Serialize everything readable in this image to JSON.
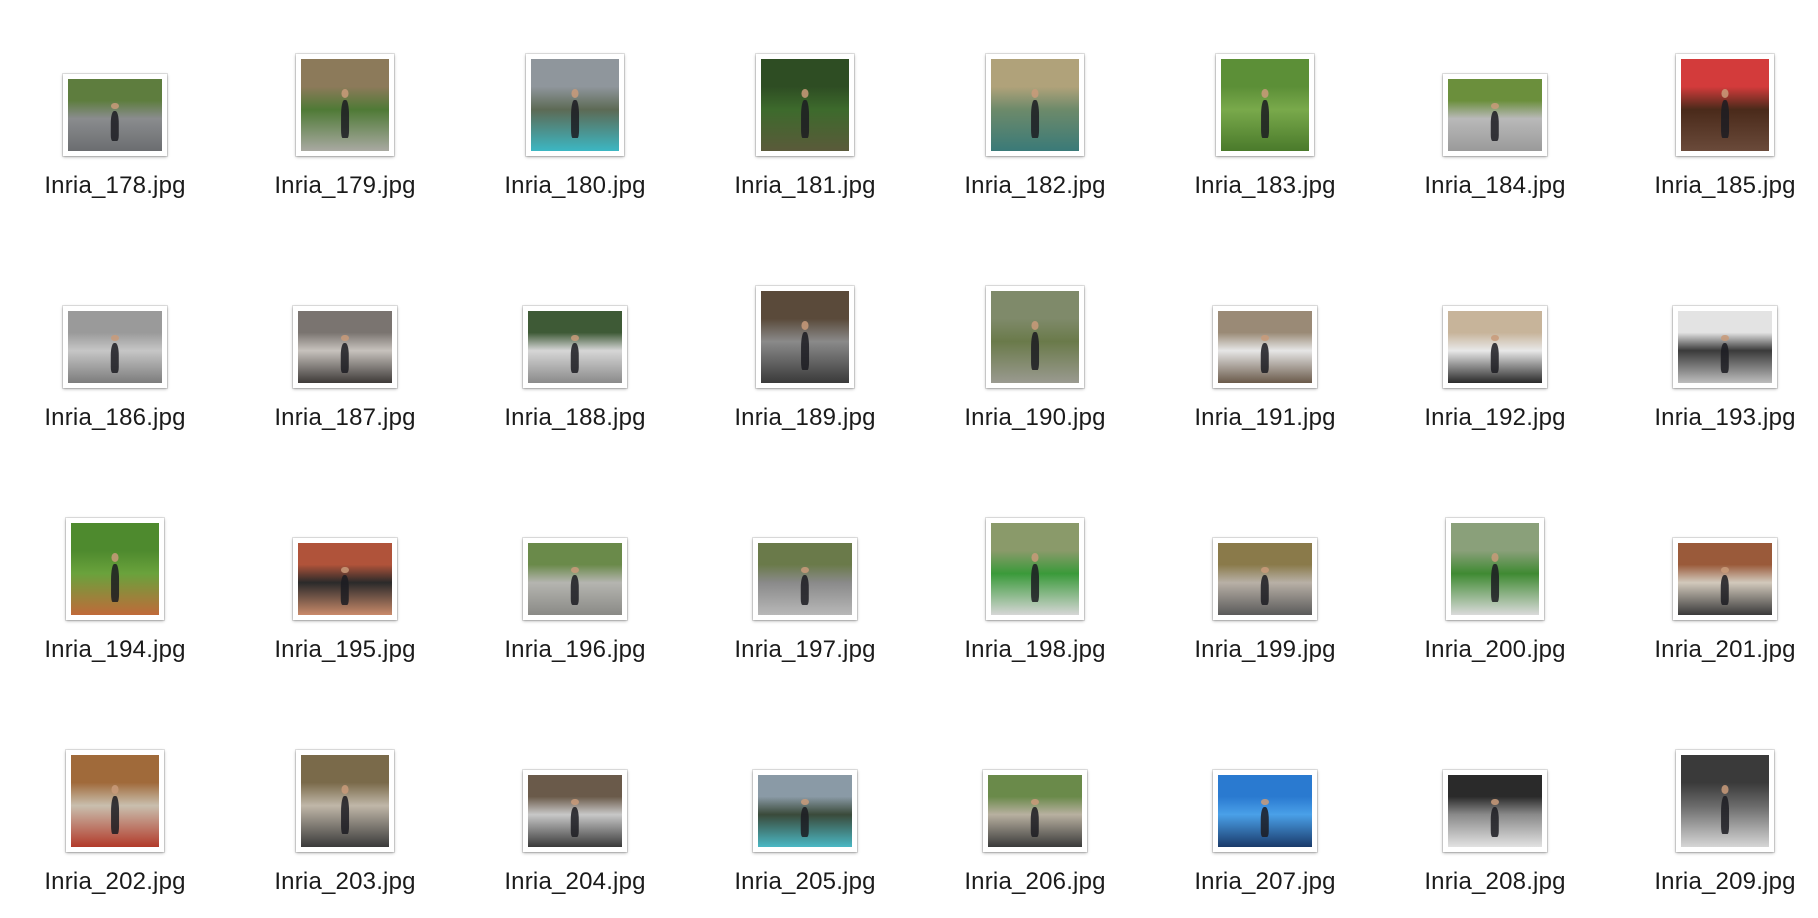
{
  "files": [
    {
      "name": "Inria_178.jpg",
      "colors": [
        "#5e7d3e",
        "#8a8c8e",
        "#6b6d70"
      ],
      "orientation": "landscape"
    },
    {
      "name": "Inria_179.jpg",
      "colors": [
        "#8c7a5a",
        "#4f7a36",
        "#a9a9a2"
      ],
      "orientation": "portrait"
    },
    {
      "name": "Inria_180.jpg",
      "colors": [
        "#8f969c",
        "#5d6a55",
        "#3cb7c3"
      ],
      "orientation": "portrait"
    },
    {
      "name": "Inria_181.jpg",
      "colors": [
        "#2e4d23",
        "#3d6a2c",
        "#5a5a3a"
      ],
      "orientation": "portrait"
    },
    {
      "name": "Inria_182.jpg",
      "colors": [
        "#b0a27a",
        "#6d8a6a",
        "#3a7a78"
      ],
      "orientation": "portrait"
    },
    {
      "name": "Inria_183.jpg",
      "colors": [
        "#5c8f37",
        "#79a94b",
        "#4a7a2b"
      ],
      "orientation": "portrait"
    },
    {
      "name": "Inria_184.jpg",
      "colors": [
        "#6b8f3c",
        "#b9b9b9",
        "#9a9a9a"
      ],
      "orientation": "landscape"
    },
    {
      "name": "Inria_185.jpg",
      "colors": [
        "#d33b3b",
        "#4a2a1a",
        "#6a4a3a"
      ],
      "orientation": "portrait"
    },
    {
      "name": "Inria_186.jpg",
      "colors": [
        "#9a9a9a",
        "#c6c6c6",
        "#7c7c7c"
      ],
      "orientation": "landscape"
    },
    {
      "name": "Inria_187.jpg",
      "colors": [
        "#7a7470",
        "#c7c2bd",
        "#3e3a38"
      ],
      "orientation": "landscape"
    },
    {
      "name": "Inria_188.jpg",
      "colors": [
        "#3e5a36",
        "#d6d6d6",
        "#8a8a8a"
      ],
      "orientation": "landscape"
    },
    {
      "name": "Inria_189.jpg",
      "colors": [
        "#5a4a3a",
        "#8a8a8a",
        "#3a3a3a"
      ],
      "orientation": "portrait"
    },
    {
      "name": "Inria_190.jpg",
      "colors": [
        "#7f8a6a",
        "#6a7a4a",
        "#9a9a90"
      ],
      "orientation": "portrait"
    },
    {
      "name": "Inria_191.jpg",
      "colors": [
        "#9a8a76",
        "#e6e6e6",
        "#6a5a4a"
      ],
      "orientation": "landscape"
    },
    {
      "name": "Inria_192.jpg",
      "colors": [
        "#c7b49a",
        "#e8e8e8",
        "#2a2a2a"
      ],
      "orientation": "landscape"
    },
    {
      "name": "Inria_193.jpg",
      "colors": [
        "#e3e3e3",
        "#3a3a3a",
        "#bdbdbd"
      ],
      "orientation": "landscape"
    },
    {
      "name": "Inria_194.jpg",
      "colors": [
        "#4e8a2e",
        "#6aa23c",
        "#c06a3a"
      ],
      "orientation": "portrait"
    },
    {
      "name": "Inria_195.jpg",
      "colors": [
        "#b0533a",
        "#2a2a2a",
        "#c98a6a"
      ],
      "orientation": "landscape"
    },
    {
      "name": "Inria_196.jpg",
      "colors": [
        "#6a8a4a",
        "#b5b5b0",
        "#8a8a86"
      ],
      "orientation": "landscape"
    },
    {
      "name": "Inria_197.jpg",
      "colors": [
        "#6a7a4a",
        "#8a8a8a",
        "#b8b8b8"
      ],
      "orientation": "landscape"
    },
    {
      "name": "Inria_198.jpg",
      "colors": [
        "#8a9a6a",
        "#3a9a3a",
        "#d6d6d6"
      ],
      "orientation": "portrait"
    },
    {
      "name": "Inria_199.jpg",
      "colors": [
        "#8a7a4a",
        "#b8b0a6",
        "#5a5a5a"
      ],
      "orientation": "landscape"
    },
    {
      "name": "Inria_200.jpg",
      "colors": [
        "#8aa07a",
        "#3f8a32",
        "#dadada"
      ],
      "orientation": "portrait"
    },
    {
      "name": "Inria_201.jpg",
      "colors": [
        "#9a5a3a",
        "#d2c9bc",
        "#3a3a3a"
      ],
      "orientation": "landscape"
    },
    {
      "name": "Inria_202.jpg",
      "colors": [
        "#a06a3a",
        "#c9bfae",
        "#b23a2a"
      ],
      "orientation": "portrait"
    },
    {
      "name": "Inria_203.jpg",
      "colors": [
        "#7a6a4a",
        "#c0b7a8",
        "#3a3a3a"
      ],
      "orientation": "portrait"
    },
    {
      "name": "Inria_204.jpg",
      "colors": [
        "#6a5a4a",
        "#c8c8c8",
        "#3a3a3a"
      ],
      "orientation": "landscape"
    },
    {
      "name": "Inria_205.jpg",
      "colors": [
        "#8a9aa6",
        "#3a4a3a",
        "#4ab8c4"
      ],
      "orientation": "landscape"
    },
    {
      "name": "Inria_206.jpg",
      "colors": [
        "#6a8a4a",
        "#b8b0a0",
        "#3a3a3a"
      ],
      "orientation": "landscape"
    },
    {
      "name": "Inria_207.jpg",
      "colors": [
        "#2a7ad0",
        "#4aa0e8",
        "#1a3a6a"
      ],
      "orientation": "landscape"
    },
    {
      "name": "Inria_208.jpg",
      "colors": [
        "#2a2a2a",
        "#8a8a8a",
        "#e2e2e2"
      ],
      "orientation": "landscape"
    },
    {
      "name": "Inria_209.jpg",
      "colors": [
        "#3a3a3a",
        "#6a6a6a",
        "#d6d6d6"
      ],
      "orientation": "portrait"
    }
  ]
}
